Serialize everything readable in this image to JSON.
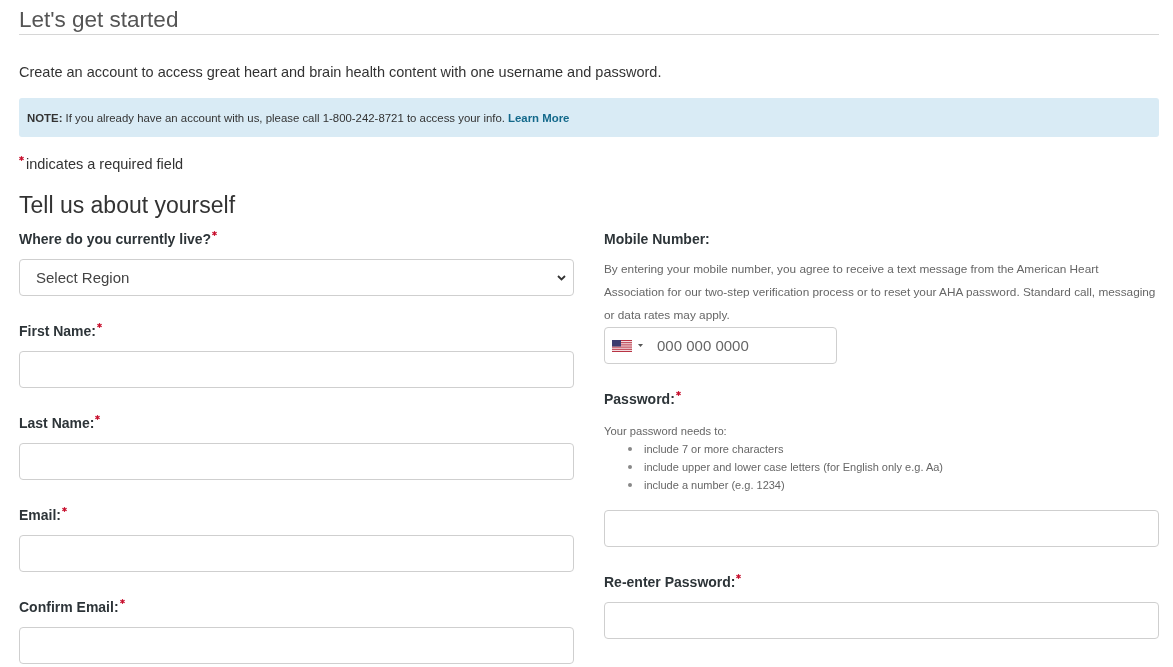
{
  "page_title": "Let's get started",
  "intro": "Create an account to access great heart and brain health content with one username and password.",
  "note": {
    "text": "**NOTE:** If you already have an account with us, please call 1-800-242-8721 to access your info.",
    "link": "Learn More"
  },
  "required_legend": "indicates a required field",
  "section_title": "Tell us about yourself",
  "left_fields": [
    {
      "kind": "select",
      "label": "Where do you currently live?",
      "required": true,
      "value": "Select Region"
    },
    {
      "kind": "text",
      "label": "First Name:",
      "required": true
    },
    {
      "kind": "text",
      "label": "Last Name:",
      "required": true
    },
    {
      "kind": "text",
      "label": "Email:",
      "required": true
    },
    {
      "kind": "text",
      "label": "Confirm Email:",
      "required": true
    }
  ],
  "right_fields": [
    {
      "kind": "phone",
      "label": "Mobile Number:",
      "required": false,
      "help": "By entering your mobile number, you agree to receive a text message from the American Heart Association for our two-step verification process or to reset your AHA password. Standard call, messaging or data rates may apply.",
      "placeholder": "000 000 0000"
    },
    {
      "kind": "password",
      "label": "Password:",
      "required": true,
      "help": "Your password needs to:",
      "rules": [
        "include 7 or more characters",
        "include upper and lower case letters (for English only e.g. Aa)",
        "include a number (e.g. 1234)"
      ]
    },
    {
      "kind": "password",
      "label": "Re-enter Password:",
      "required": true
    }
  ]
}
